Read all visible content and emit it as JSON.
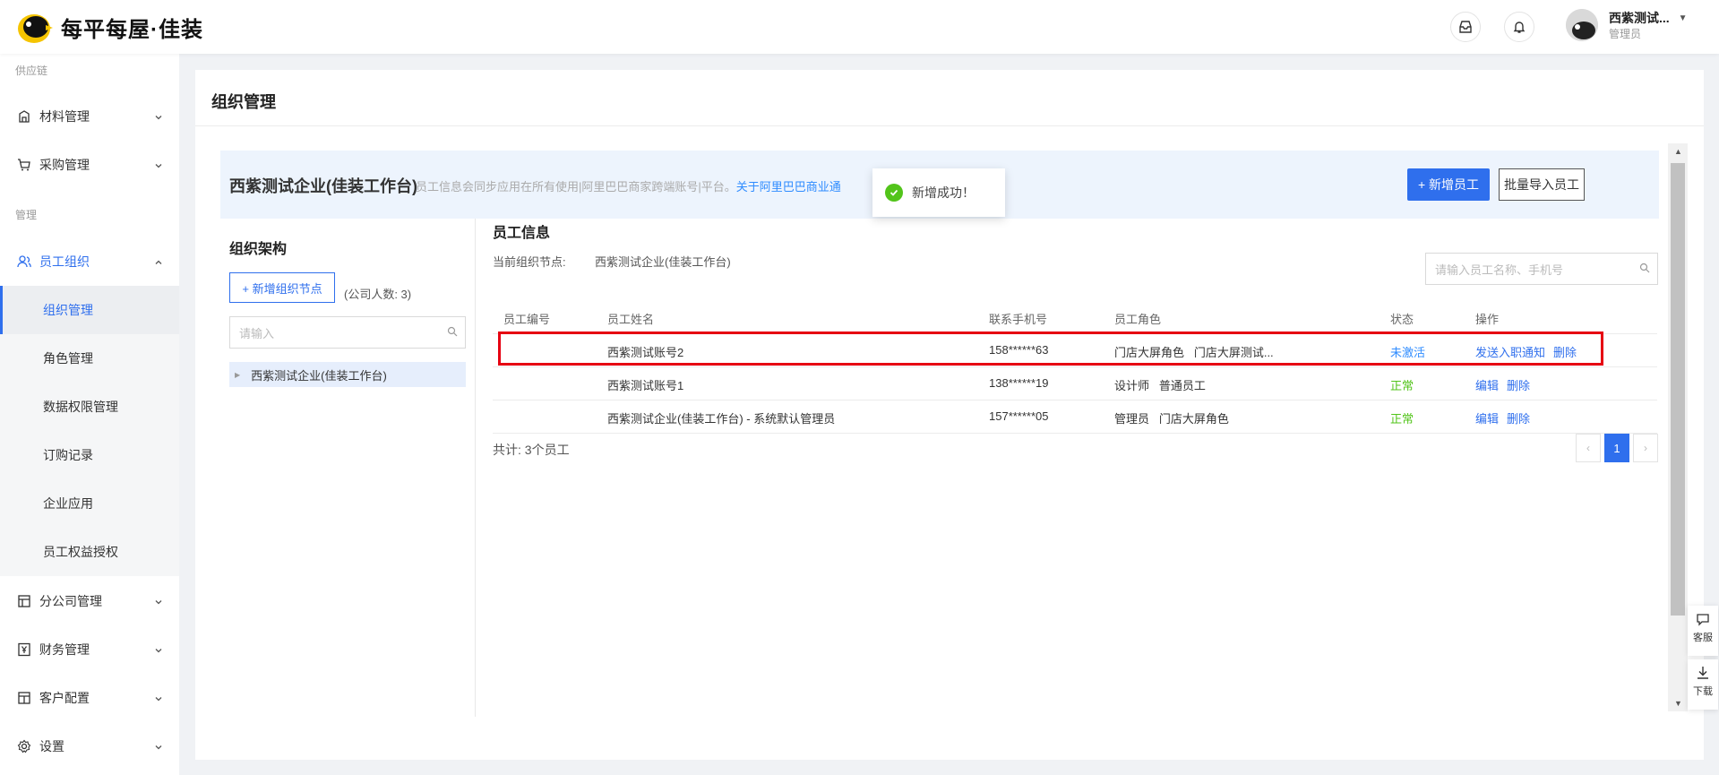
{
  "header": {
    "brand": "每平每屋·佳装",
    "user_name": "西紫测试...",
    "user_role": "管理员"
  },
  "sidebar": {
    "group_supply": "供应链",
    "group_manage": "管理",
    "items": {
      "materials": "材料管理",
      "purchase": "采购管理",
      "staff_org": "员工组织",
      "branch": "分公司管理",
      "finance": "财务管理",
      "customer_config": "客户配置",
      "settings": "设置"
    },
    "sub_items": {
      "org_manage": "组织管理",
      "role_manage": "角色管理",
      "data_permission": "数据权限管理",
      "order_records": "订购记录",
      "enterprise_apps": "企业应用",
      "staff_benefits": "员工权益授权"
    }
  },
  "main": {
    "page_title": "组织管理",
    "company_name": "西紫测试企业(佳装工作台)",
    "banner_desc": "员工信息会同步应用在所有使用|阿里巴巴商家跨端账号|平台。",
    "banner_link": "关于阿里巴巴商业通",
    "add_employee_btn": "+ 新增员工",
    "batch_import_btn": "批量导入员工",
    "toast": "新增成功！",
    "org": {
      "title": "组织架构",
      "add_node_btn": "+ 新增组织节点",
      "count": "(公司人数: 3)",
      "search_placeholder": "请输入",
      "tree_root": "西紫测试企业(佳装工作台)"
    },
    "employees": {
      "title": "员工信息",
      "current_node_label": "当前组织节点:",
      "current_node_value": "西紫测试企业(佳装工作台)",
      "search_placeholder": "请输入员工名称、手机号",
      "columns": [
        "员工编号",
        "员工姓名",
        "联系手机号",
        "员工角色",
        "状态",
        "操作"
      ],
      "rows": [
        {
          "id": "",
          "name": "西紫测试账号2",
          "phone": "158******63",
          "roles": "门店大屏角色   门店大屏测试...",
          "status": "未激活",
          "actions": [
            "发送入职通知",
            "删除"
          ]
        },
        {
          "id": "",
          "name": "西紫测试账号1",
          "phone": "138******19",
          "roles": "设计师   普通员工",
          "status": "正常",
          "actions": [
            "编辑",
            "删除"
          ]
        },
        {
          "id": "",
          "name": "西紫测试企业(佳装工作台) - 系统默认管理员",
          "phone": "157******05",
          "roles": "管理员   门店大屏角色",
          "status": "正常",
          "actions": [
            "编辑",
            "删除"
          ]
        }
      ],
      "total": "共计: 3个员工",
      "current_page": "1"
    }
  },
  "float_tools": {
    "service": "客服",
    "download": "下载"
  },
  "colors": {
    "primary": "#2f6fed",
    "success": "#52c41a",
    "highlight": "#e60012"
  }
}
